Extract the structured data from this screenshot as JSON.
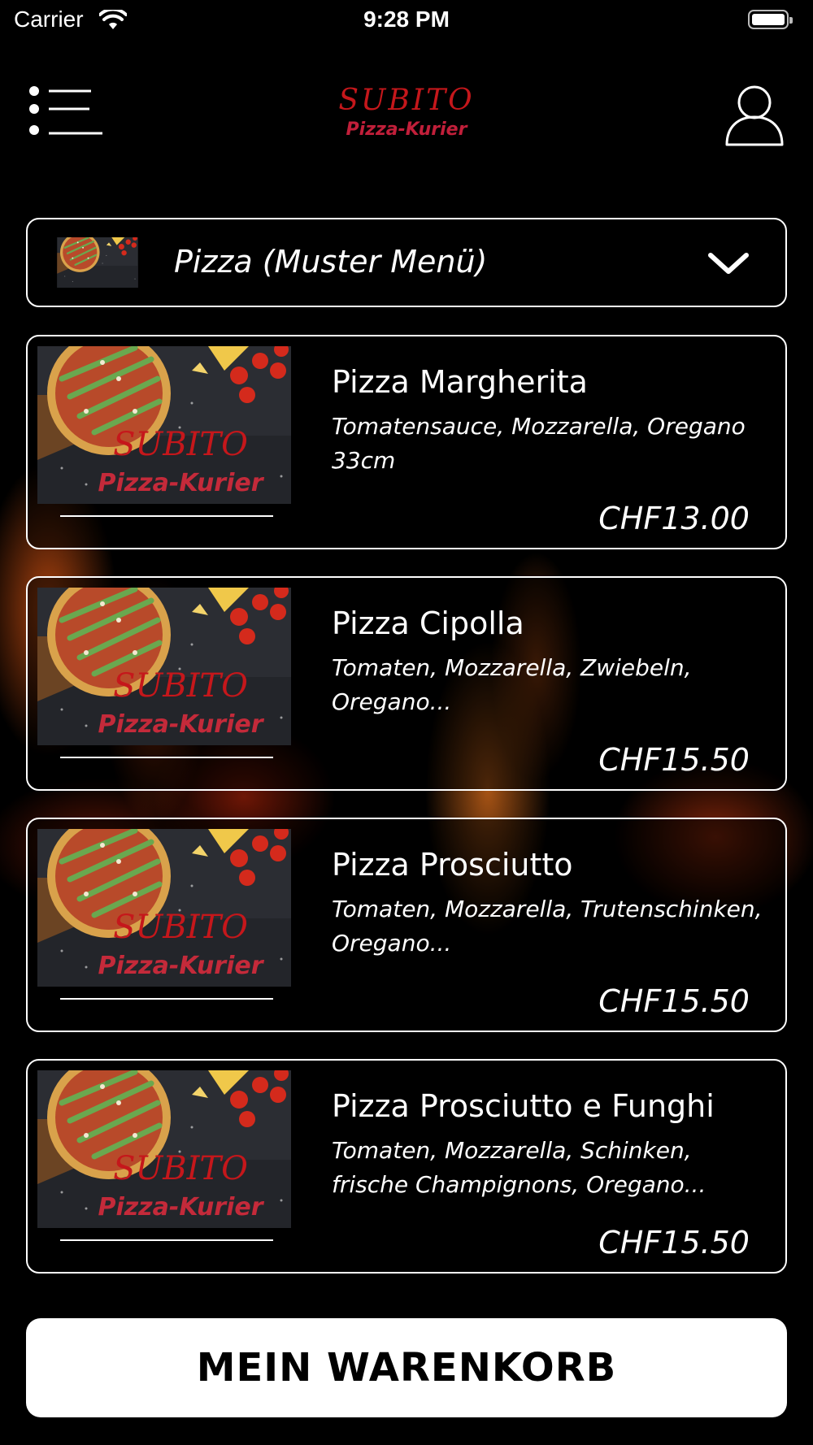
{
  "status_bar": {
    "carrier": "Carrier",
    "time": "9:28 PM"
  },
  "header": {
    "logo_line1": "SUBITO",
    "logo_line2": "Pizza-Kurier",
    "menu_icon": "list-menu-icon",
    "profile_icon": "user-icon"
  },
  "category": {
    "selected": "Pizza (Muster Menü)",
    "icon": "chevron-down-icon"
  },
  "thumbnail": {
    "brand_line1": "SUBITO",
    "brand_line2": "Pizza-Kurier"
  },
  "items": [
    {
      "name": "Pizza Margherita",
      "description": "Tomatensauce, Mozzarella, Oregano 33cm",
      "price": "CHF13.00"
    },
    {
      "name": "Pizza Cipolla",
      "description": "Tomaten, Mozzarella, Zwiebeln, Oregano...",
      "price": "CHF15.50"
    },
    {
      "name": "Pizza Prosciutto",
      "description": "Tomaten, Mozzarella, Trutenschinken, Oregano...",
      "price": "CHF15.50"
    },
    {
      "name": "Pizza Prosciutto e Funghi",
      "description": "Tomaten, Mozzarella, Schinken, frische Champignons, Oregano...",
      "price": "CHF15.50"
    }
  ],
  "cart_button": {
    "label": "MEIN WARENKORB"
  },
  "colors": {
    "background": "#000000",
    "brand_red": "#c5171b",
    "button_bg": "#ffffff"
  }
}
